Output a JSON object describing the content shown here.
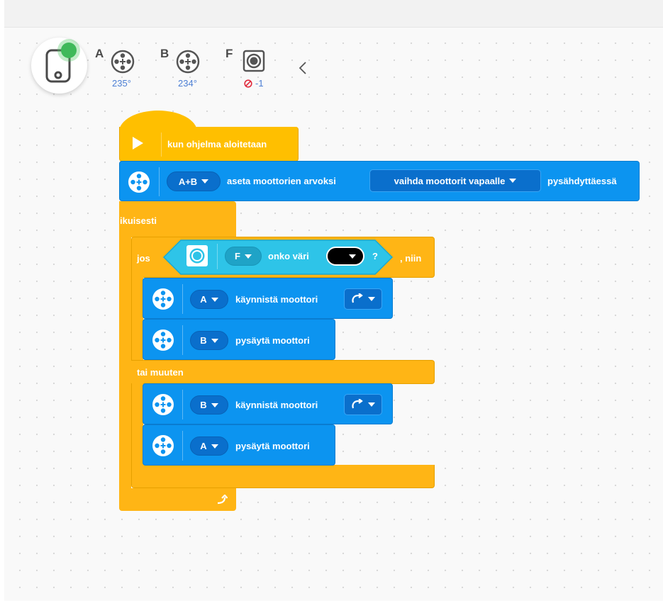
{
  "ports": [
    {
      "letter": "A",
      "value": "235°"
    },
    {
      "letter": "B",
      "value": "234°"
    },
    {
      "letter": "F",
      "value": "-1"
    }
  ],
  "program": {
    "hat_label": "kun ohjelma aloitetaan",
    "set_stop": {
      "motors": "A+B",
      "label": "aseta moottorien arvoksi",
      "mode": "vaihda moottorit vapaalle",
      "suffix": "pysähdyttäessä"
    },
    "forever_label": "ikuisesti",
    "if": {
      "jos_label": "jos",
      "port": "F",
      "question": "onko väri",
      "qmark": "?",
      "niin_label": ", niin",
      "color": "#000000"
    },
    "then_blocks": [
      {
        "port": "A",
        "label": "käynnistä moottori"
      },
      {
        "port": "B",
        "label": "pysäytä moottori"
      }
    ],
    "else_label": "tai muuten",
    "else_blocks": [
      {
        "port": "B",
        "label": "käynnistä moottori"
      },
      {
        "port": "A",
        "label": "pysäytä moottori"
      }
    ]
  },
  "colors": {
    "events": "#ffbf00",
    "control": "#ffb515",
    "motors": "#0c94f0",
    "sensors": "#2ec4e8"
  }
}
